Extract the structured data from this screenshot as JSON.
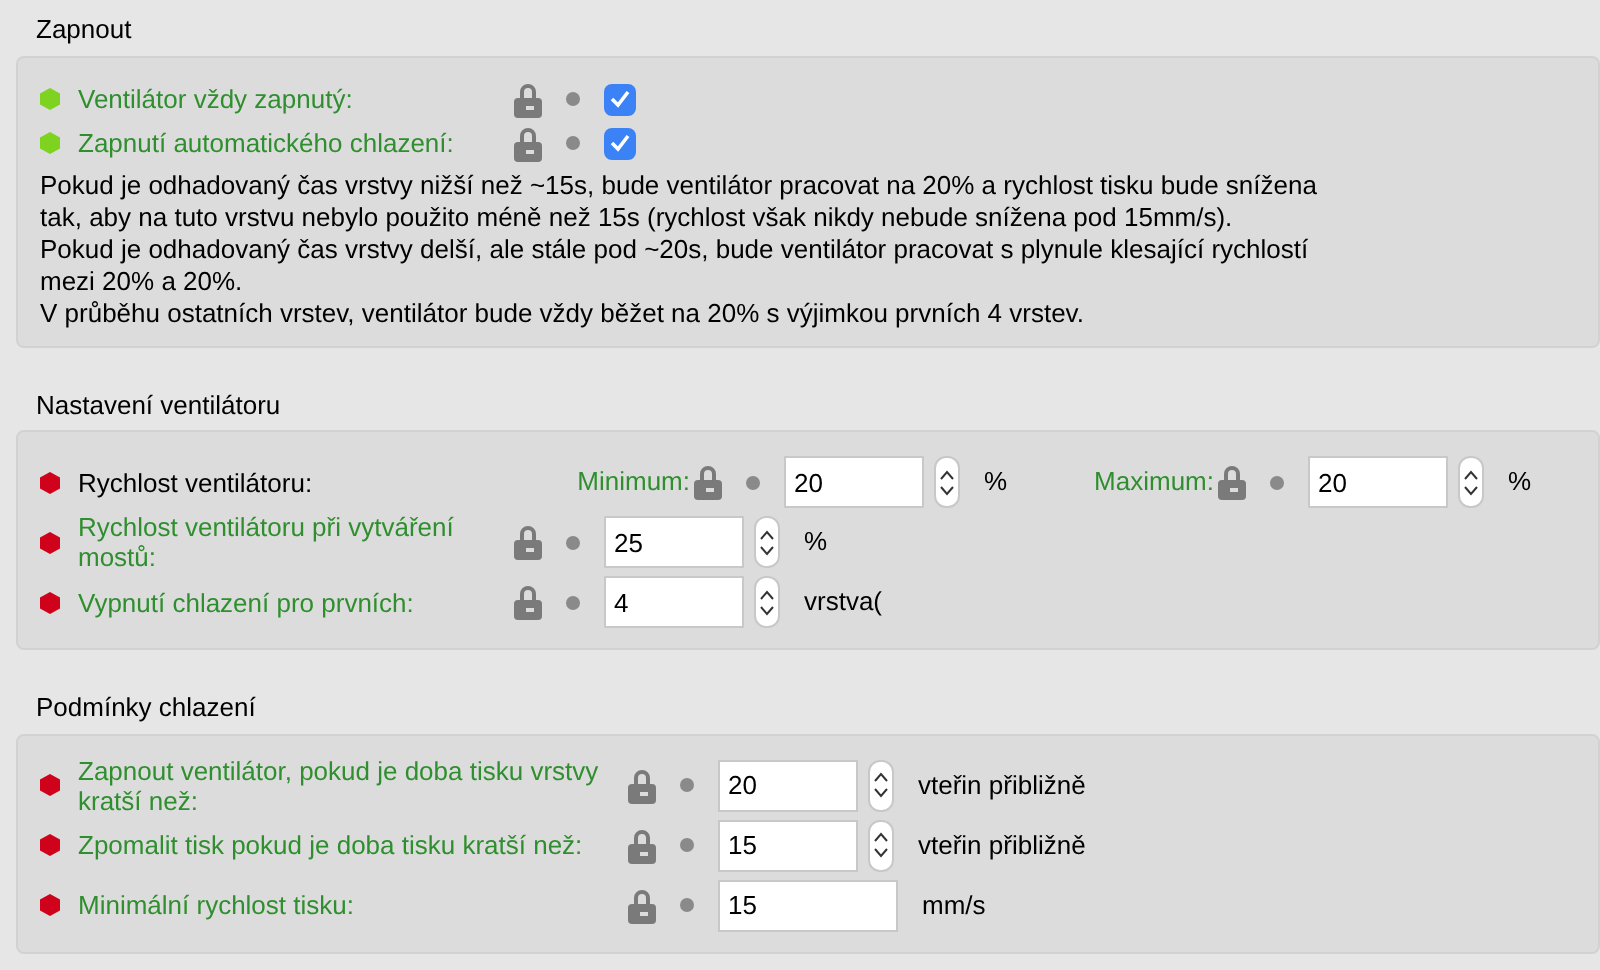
{
  "sections": [
    {
      "title": "Zapnout",
      "options": [
        {
          "kind": "checkbox",
          "label": "Ventilátor vždy zapnutý:",
          "color": "#7ed321",
          "modified": true,
          "checked": true
        },
        {
          "kind": "checkbox",
          "label": "Zapnutí automatického chlazení:",
          "color": "#7ed321",
          "modified": true,
          "checked": true
        }
      ],
      "description_lines": [
        "Pokud je odhadovaný čas vrstvy nižší než ~15s, bude ventilátor pracovat na 20% a rychlost tisku bude snížena",
        "tak, aby na tuto vrstvu nebylo použito méně než 15s (rychlost však nikdy nebude snížena pod 15mm/s).",
        "Pokud je odhadovaný čas vrstvy delší, ale stále pod ~20s, bude ventilátor pracovat s plynule klesající rychlostí",
        "mezi 20% a 20%.",
        "V průběhu ostatních vrstev, ventilátor bude vždy běžet na 20% s výjimkou prvních 4 vrstev."
      ]
    },
    {
      "title": "Nastavení ventilátoru",
      "options": [
        {
          "kind": "dual",
          "label": "Rychlost ventilátoru:",
          "color": "#d0021b",
          "modified": false,
          "fields": [
            {
              "label": "Minimum:",
              "modified": true,
              "value": "20",
              "spinner": true,
              "unit": "%"
            },
            {
              "label": "Maximum:",
              "modified": true,
              "value": "20",
              "spinner": true,
              "unit": "%"
            }
          ]
        },
        {
          "kind": "spin",
          "label": "Rychlost ventilátoru při vytváření mostů:",
          "color": "#d0021b",
          "modified": true,
          "value": "25",
          "spinner": true,
          "unit": "%"
        },
        {
          "kind": "spin",
          "label": "Vypnutí chlazení pro prvních:",
          "color": "#d0021b",
          "modified": true,
          "value": "4",
          "spinner": true,
          "unit": "vrstva("
        }
      ]
    },
    {
      "title": "Podmínky chlazení",
      "options": [
        {
          "kind": "spin",
          "label": "Zapnout ventilátor, pokud je doba tisku vrstvy kratší než:",
          "color": "#d0021b",
          "modified": true,
          "value": "20",
          "spinner": true,
          "unit": "vteřin přibližně"
        },
        {
          "kind": "spin",
          "label": "Zpomalit tisk pokud je doba tisku kratší než:",
          "color": "#d0021b",
          "modified": true,
          "value": "15",
          "spinner": true,
          "unit": "vteřin přibližně"
        },
        {
          "kind": "spin",
          "label": "Minimální rychlost tisku:",
          "color": "#d0021b",
          "modified": true,
          "value": "15",
          "spinner": false,
          "unit": "mm/s"
        }
      ]
    }
  ]
}
